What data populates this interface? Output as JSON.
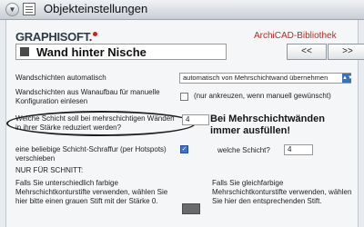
{
  "header": {
    "title": "Objekteinstellungen"
  },
  "branding": {
    "logo": "GRAPHISOFT.",
    "library": "ArchiCAD-Bibliothek"
  },
  "object": {
    "name": "Wand hinter Nische",
    "prev_label": "<<",
    "next_label": ">>"
  },
  "rows": {
    "auto_layers_label": "Wandschichten automatisch",
    "auto_layers_value": "automatisch von Mehrschichtwand übernehmen",
    "structure_label": "Wandschichten aus Wanaufbau für manuelle Konfiguration einlesen",
    "structure_hint": "(nur ankreuzen, wenn manuell gewünscht)",
    "reduce_layer_label": "Welche Schicht soll bei mehrschichtigen Wänden in ihrer Stärke reduziert werden?",
    "reduce_layer_value": "4",
    "reduce_warning": "Bei Mehrschichtwänden immer ausfüllen!",
    "hatch_label": "eine beliebige Schicht-Schraffur (per Hotspots) verschieben",
    "which_layer_label": "welche Schicht?",
    "which_layer_value": "4",
    "only_section": "NUR FÜR SCHNITT:",
    "pen_left_text": "Falls Sie unterschiedlich farbige Mehrschichtkonturstifte verwenden, wählen Sie hier bitte einen grauen Stift mit der Stärke 0.",
    "pen_right_text": "Falls Sie gleichfarbige Mehrschichtkonturstifte verwenden, wählen Sie hier den entsprechenden Stift."
  },
  "state": {
    "structure_checked": false,
    "hatch_checked": true
  },
  "colors": {
    "library": "#c0271c",
    "checkbox_checked": "#3d6fd0",
    "pen_swatch": "#6a6a6a"
  },
  "icons": {
    "collapse": "triangle-down-icon",
    "header": "settings-list-icon",
    "object": "object-icon"
  }
}
